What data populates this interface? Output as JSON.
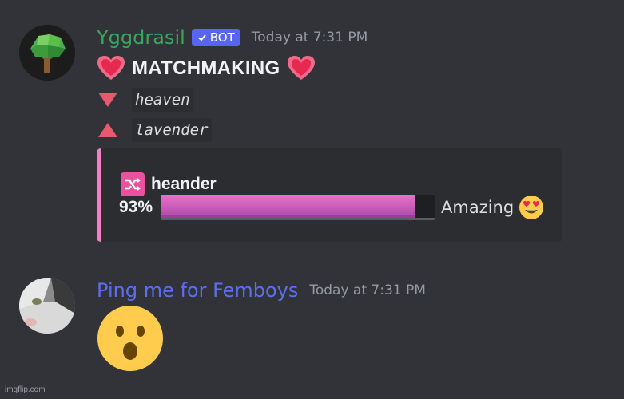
{
  "messages": [
    {
      "author": "Yggdrasil",
      "author_color": "#3ba55c",
      "bot_tag": "BOT",
      "timestamp": "Today at 7:31 PM",
      "title": "MATCHMAKING",
      "names": [
        {
          "direction": "down",
          "name": "heaven"
        },
        {
          "direction": "up",
          "name": "lavender"
        }
      ],
      "embed": {
        "accent_color": "#ee82c5",
        "pair_name": "heander",
        "percent_label": "93%",
        "percent_value": 93,
        "rating": "Amazing"
      }
    },
    {
      "author": "Ping me for Femboys",
      "author_color": "#5b6ff0",
      "timestamp": "Today at 7:31 PM",
      "content_emoji": "surprised-face"
    }
  ],
  "watermark": "imgflip.com"
}
